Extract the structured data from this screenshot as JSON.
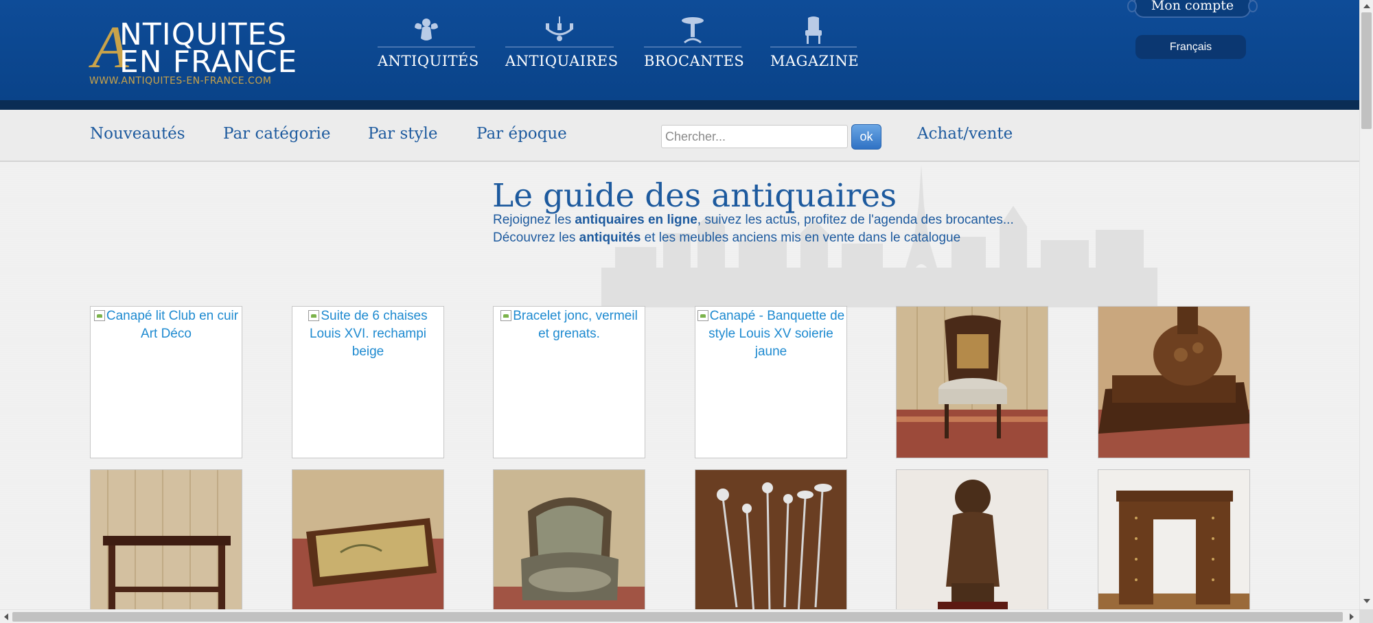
{
  "brand": {
    "big_letter": "A",
    "line1": "NTIQUITES",
    "line2": "EN FRANCE",
    "url": "WWW.ANTIQUITES-EN-FRANCE.COM",
    "gold_color": "#c9a34a",
    "header_color": "#0e4c98"
  },
  "main_nav": [
    {
      "label": "ANTIQUITÉS",
      "icon": "cherub-icon"
    },
    {
      "label": "ANTIQUAIRES",
      "icon": "chandelier-icon"
    },
    {
      "label": "BROCANTES",
      "icon": "pedestal-table-icon"
    },
    {
      "label": "MAGAZINE",
      "icon": "armchair-icon"
    }
  ],
  "account": {
    "label": "Mon compte",
    "language": "Français"
  },
  "subnav": {
    "links": [
      "Nouveautés",
      "Par catégorie",
      "Par style",
      "Par époque"
    ],
    "search_placeholder": "Chercher...",
    "search_button": "ok",
    "trade_link": "Achat/vente",
    "link_color": "#1d5a9e"
  },
  "intro": {
    "title": "Le guide des antiquaires",
    "line1_pre": "Rejoignez les ",
    "line1_bold": "antiquaires en ligne",
    "line1_post": ", suivez les actus, profitez de l'agenda des brocantes...",
    "line2_pre": "Découvrez les ",
    "line2_bold": "antiquités",
    "line2_post": " et les meubles anciens mis en vente dans le catalogue"
  },
  "products": [
    {
      "alt": "Canapé lit Club en cuir Art Déco",
      "image": "broken"
    },
    {
      "alt": "Suite de 6 chaises Louis XVI. rechampi beige",
      "image": "broken"
    },
    {
      "alt": "Bracelet jonc, vermeil et grenats.",
      "image": "broken"
    },
    {
      "alt": "Canapé - Banquette de style Louis XV soierie jaune",
      "image": "broken"
    },
    {
      "alt": "",
      "image": "cane-back-chair"
    },
    {
      "alt": "",
      "image": "carved-pedestal"
    },
    {
      "alt": "",
      "image": "console-table"
    },
    {
      "alt": "",
      "image": "coffee-table"
    },
    {
      "alt": "",
      "image": "upholstered-armchair"
    },
    {
      "alt": "",
      "image": "silver-hat-pins"
    },
    {
      "alt": "",
      "image": "bronze-statue"
    },
    {
      "alt": "",
      "image": "pedestal-desk"
    }
  ]
}
